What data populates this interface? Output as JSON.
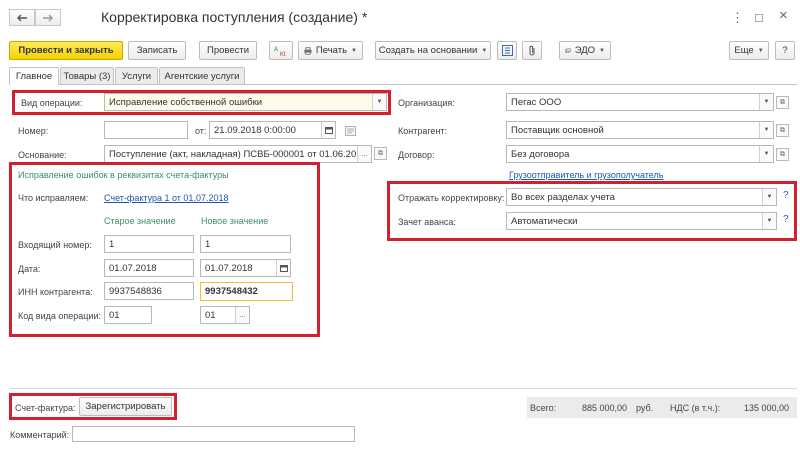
{
  "window": {
    "title": "Корректировка поступления (создание) *",
    "controls": {
      "menu": "⋮",
      "restore": "□",
      "close": "×"
    }
  },
  "nav": {
    "back_icon": "arrow-left-icon",
    "forward_icon": "arrow-right-icon"
  },
  "toolbar": {
    "post_close": "Провести и закрыть",
    "save": "Записать",
    "post": "Провести",
    "print": "Печать",
    "create_based_on": "Создать на основании",
    "edo": "ЭДО",
    "more": "Еще",
    "help": "?"
  },
  "tabs": [
    {
      "label": "Главное",
      "active": true
    },
    {
      "label": "Товары (3)",
      "active": false
    },
    {
      "label": "Услуги",
      "active": false
    },
    {
      "label": "Агентские услуги",
      "active": false
    }
  ],
  "form": {
    "operation_type_label": "Вид операции:",
    "operation_type_value": "Исправление собственной ошибки",
    "number_label": "Номер:",
    "number_value": "",
    "date_prefix": "от:",
    "date_value": "21.09.2018 0:00:00",
    "basis_label": "Основание:",
    "basis_value": "Поступление (акт, накладная) ПСВБ-000001 от 01.06.2018 2",
    "organization_label": "Организация:",
    "organization_value": "Пегас ООО",
    "counterparty_label": "Контрагент:",
    "counterparty_value": "Поставщик основной",
    "contract_label": "Договор:",
    "contract_value": "Без договора",
    "shipper_link": "Грузоотправитель и грузополучатель",
    "reflect_label": "Отражать корректировку:",
    "reflect_value": "Во всех разделах учета",
    "advance_label": "Зачет аванса:",
    "advance_value": "Автоматически"
  },
  "invoice_fix": {
    "section_title": "Исправление ошибок в реквизитах счета-фактуры",
    "what_label": "Что исправляем:",
    "what_link": "Счет-фактура 1 от 01.07.2018",
    "old_header": "Старое значение",
    "new_header": "Новое значение",
    "rows": [
      {
        "label": "Входящий номер:",
        "old": "1",
        "new": "1"
      },
      {
        "label": "Дата:",
        "old": "01.07.2018",
        "new": "01.07.2018"
      },
      {
        "label": "ИНН контрагента:",
        "old": "9937548836",
        "new": "9937548432"
      },
      {
        "label": "Код вида операции:",
        "old": "01",
        "new": "01"
      }
    ]
  },
  "footer": {
    "invoice_label": "Счет-фактура:",
    "register_button": "Зарегистрировать",
    "comment_label": "Комментарий:",
    "comment_value": "",
    "total_label": "Всего:",
    "total_value": "885 000,00",
    "currency": "руб.",
    "vat_label": "НДС (в т.ч.):",
    "vat_value": "135 000,00"
  },
  "colors": {
    "highlight_box": "#d2202f",
    "primary_button": "#f5d200",
    "link": "#1d55b6",
    "section_green": "#3c8f63"
  }
}
